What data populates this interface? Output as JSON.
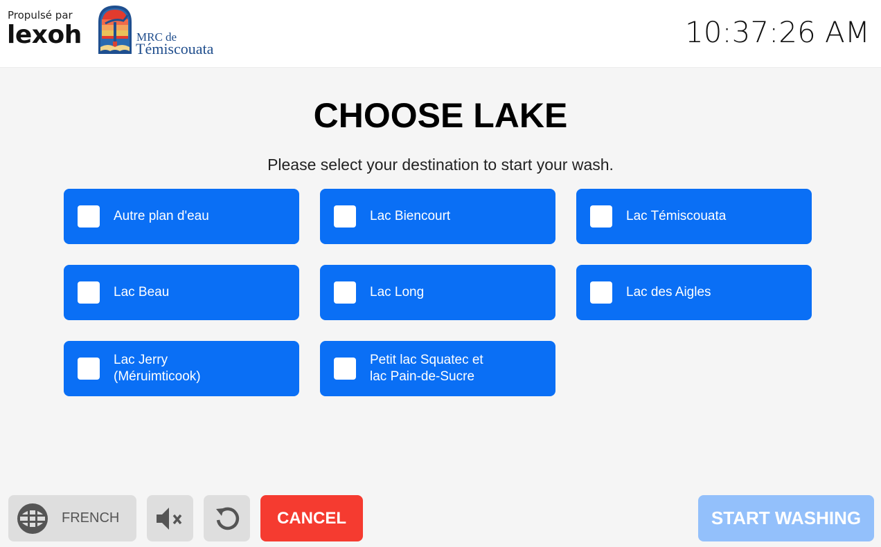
{
  "header": {
    "powered_by": "Propulsé par",
    "brand": "lexoh",
    "org_line1": "MRC de",
    "org_line2": "Témiscouata",
    "clock": "10:37:26 AM"
  },
  "main": {
    "title": "CHOOSE LAKE",
    "subtitle": "Please select your destination to start your wash.",
    "lakes": [
      {
        "label": "Autre plan d'eau",
        "checked": false
      },
      {
        "label": "Lac Biencourt",
        "checked": false
      },
      {
        "label": "Lac Témiscouata",
        "checked": false
      },
      {
        "label": "Lac Beau",
        "checked": false
      },
      {
        "label": "Lac Long",
        "checked": false
      },
      {
        "label": "Lac des Aigles",
        "checked": false
      },
      {
        "label": "Lac Jerry\n(Méruimticook)",
        "checked": false
      },
      {
        "label": "Petit lac Squatec et\nlac Pain-de-Sucre",
        "checked": false
      }
    ]
  },
  "footer": {
    "language_label": "FRENCH",
    "language_icon": "globe-icon",
    "mute_icon": "speaker-muted-icon",
    "reset_icon": "refresh-icon",
    "cancel_label": "CANCEL",
    "start_label": "START WASHING",
    "start_enabled": false
  },
  "colors": {
    "lake_button": "#0a6ff5",
    "cancel": "#f53b30",
    "start_disabled": "#93c0fb",
    "neutral_button": "#dedede"
  }
}
